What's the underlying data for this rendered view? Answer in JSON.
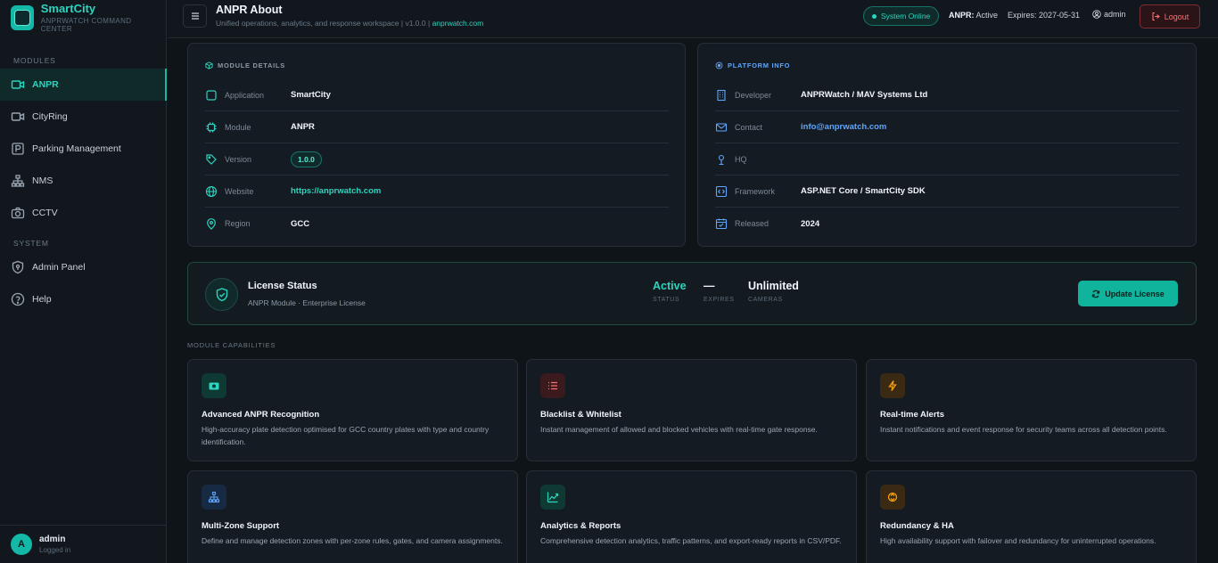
{
  "brand": {
    "title": "SmartCity",
    "subtitle": "ANPRWATCH COMMAND CENTER"
  },
  "sidebar": {
    "modules_label": "MODULES",
    "system_label": "SYSTEM",
    "items": [
      {
        "label": "ANPR",
        "icon": "camera-icon"
      },
      {
        "label": "CityRing",
        "icon": "video-icon"
      },
      {
        "label": "Parking Management",
        "icon": "parking-icon"
      },
      {
        "label": "NMS",
        "icon": "network-icon"
      },
      {
        "label": "CCTV",
        "icon": "cctv-icon"
      },
      {
        "label": "Admin Panel",
        "icon": "shield-icon"
      },
      {
        "label": "Help",
        "icon": "help-icon"
      }
    ],
    "user": {
      "initial": "A",
      "name": "admin",
      "status": "Logged in"
    }
  },
  "header": {
    "title": "ANPR About",
    "subtitle": "Unified operations, analytics, and response workspace  |  v1.0.0  |",
    "subtitle_link": "anprwatch.com",
    "status": "System Online",
    "anpr_label": "ANPR:",
    "anpr_value": "Active",
    "expires": "Expires: 2027-05-31",
    "user": "admin",
    "logout": "Logout"
  },
  "module_details": {
    "heading": "MODULE DETAILS",
    "rows": [
      {
        "label": "Application",
        "value": "SmartCity"
      },
      {
        "label": "Module",
        "value": "ANPR"
      },
      {
        "label": "Version",
        "value": "1.0.0"
      },
      {
        "label": "Website",
        "value": "https://anprwatch.com"
      },
      {
        "label": "Region",
        "value": "GCC"
      }
    ]
  },
  "platform_info": {
    "heading": "PLATFORM INFO",
    "rows": [
      {
        "label": "Developer",
        "value": "ANPRWatch / MAV Systems Ltd"
      },
      {
        "label": "Contact",
        "value": "info@anprwatch.com"
      },
      {
        "label": "HQ",
        "value": ""
      },
      {
        "label": "Framework",
        "value": "ASP.NET Core / SmartCity SDK"
      },
      {
        "label": "Released",
        "value": "2024"
      }
    ]
  },
  "license": {
    "title": "License Status",
    "subtitle": "ANPR Module · Enterprise License",
    "status_value": "Active",
    "status_label": "STATUS",
    "expires_value": "—",
    "expires_label": "EXPIRES",
    "cameras_value": "Unlimited",
    "cameras_label": "CAMERAS",
    "button": "Update License"
  },
  "capabilities": {
    "heading": "MODULE CAPABILITIES",
    "items": [
      {
        "title": "Advanced ANPR Recognition",
        "desc": "High-accuracy plate detection optimised for GCC country plates with type and country identification.",
        "icon": "camera-icon",
        "color": "#2dd4bf"
      },
      {
        "title": "Blacklist & Whitelist",
        "desc": "Instant management of allowed and blocked vehicles with real-time gate response.",
        "icon": "list-icon",
        "color": "#f87171"
      },
      {
        "title": "Real-time Alerts",
        "desc": "Instant notifications and event response for security teams across all detection points.",
        "icon": "lightning-icon",
        "color": "#f59e0b"
      },
      {
        "title": "Multi-Zone Support",
        "desc": "Define and manage detection zones with per-zone rules, gates, and camera assignments.",
        "icon": "network-icon",
        "color": "#60a5fa"
      },
      {
        "title": "Analytics & Reports",
        "desc": "Comprehensive detection analytics, traffic patterns, and export-ready reports in CSV/PDF.",
        "icon": "chart-icon",
        "color": "#2dd4bf"
      },
      {
        "title": "Redundancy & HA",
        "desc": "High availability support with failover and redundancy for uninterrupted operations.",
        "icon": "refresh-icon",
        "color": "#f59e0b"
      }
    ]
  }
}
